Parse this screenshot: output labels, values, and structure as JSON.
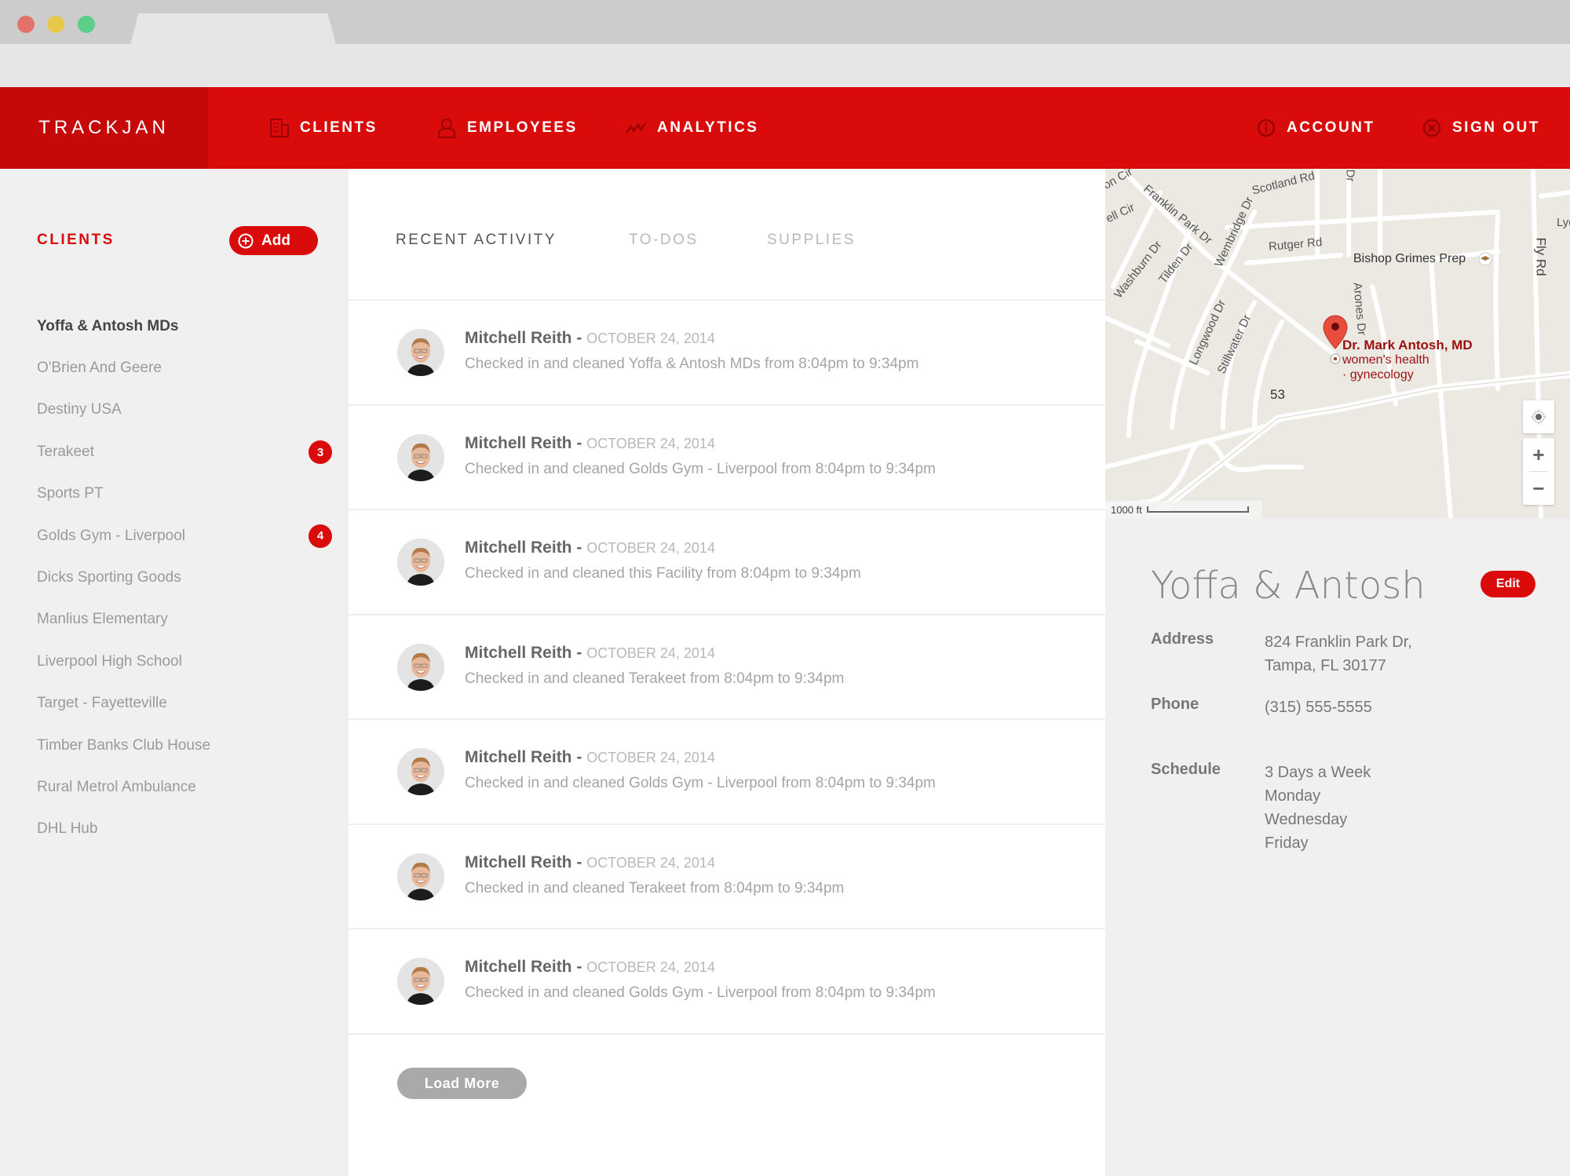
{
  "browser": {
    "tab_title": ""
  },
  "header": {
    "logo": "TRACKJAN",
    "nav": [
      {
        "label": "CLIENTS",
        "icon": "building-icon"
      },
      {
        "label": "EMPLOYEES",
        "icon": "user-icon"
      },
      {
        "label": "ANALYTICS",
        "icon": "trend-icon"
      }
    ],
    "right_nav": [
      {
        "label": "ACCOUNT",
        "icon": "info-icon"
      },
      {
        "label": "SIGN OUT",
        "icon": "close-circle-icon"
      }
    ]
  },
  "sidebar": {
    "title": "CLIENTS",
    "add_label": "Add",
    "clients": [
      {
        "name": "Yoffa & Antosh MDs",
        "active": true,
        "badge": null
      },
      {
        "name": "O'Brien And Geere",
        "badge": null
      },
      {
        "name": "Destiny USA",
        "badge": null
      },
      {
        "name": "Terakeet",
        "badge": "3"
      },
      {
        "name": "Sports PT",
        "badge": null
      },
      {
        "name": "Golds Gym - Liverpool",
        "badge": "4"
      },
      {
        "name": "Dicks Sporting Goods",
        "badge": null
      },
      {
        "name": "Manlius Elementary",
        "badge": null
      },
      {
        "name": "Liverpool High School",
        "badge": null
      },
      {
        "name": "Target - Fayetteville",
        "badge": null
      },
      {
        "name": "Timber Banks Club House",
        "badge": null
      },
      {
        "name": "Rural Metrol Ambulance",
        "badge": null
      },
      {
        "name": "DHL Hub",
        "badge": null
      }
    ]
  },
  "main": {
    "tabs": [
      {
        "label": "RECENT ACTIVITY",
        "active": true
      },
      {
        "label": "TO-DOS",
        "active": false
      },
      {
        "label": "SUPPLIES",
        "active": false
      }
    ],
    "separator": "-",
    "activities": [
      {
        "name": "Mitchell Reith",
        "date": "OCTOBER 24, 2014",
        "description": "Checked in and cleaned Yoffa & Antosh MDs from 8:04pm to 9:34pm"
      },
      {
        "name": "Mitchell Reith",
        "date": "OCTOBER 24, 2014",
        "description": "Checked in and cleaned Golds Gym - Liverpool from 8:04pm to 9:34pm"
      },
      {
        "name": "Mitchell Reith",
        "date": "OCTOBER 24, 2014",
        "description": "Checked in and cleaned this Facility from 8:04pm to 9:34pm"
      },
      {
        "name": "Mitchell Reith",
        "date": "OCTOBER 24, 2014",
        "description": "Checked in and cleaned Terakeet from 8:04pm to 9:34pm"
      },
      {
        "name": "Mitchell Reith",
        "date": "OCTOBER 24, 2014",
        "description": "Checked in and cleaned Golds Gym - Liverpool from 8:04pm to 9:34pm"
      },
      {
        "name": "Mitchell Reith",
        "date": "OCTOBER 24, 2014",
        "description": "Checked in and cleaned Terakeet from 8:04pm to 9:34pm"
      },
      {
        "name": "Mitchell Reith",
        "date": "OCTOBER 24, 2014",
        "description": "Checked in and cleaned Golds Gym - Liverpool from 8:04pm to 9:34pm"
      }
    ],
    "load_more_label": "Load More"
  },
  "map": {
    "streets": [
      "Scotland Rd",
      "Franklin Park Dr",
      "Rutger Rd",
      "Washburn Dr",
      "Tilden Dr",
      "Wembridge Dr",
      "Longwood Dr",
      "Stillwater Dr",
      "Arones Dr",
      "Fly Rd",
      "53",
      "on Cir",
      "ell Cir",
      "Lyc",
      "Dr"
    ],
    "poi": "Bishop Grimes Prep",
    "pin_title": "Dr. Mark Antosh, MD",
    "pin_subtitle_1": "women's health",
    "pin_subtitle_2": "· gynecology",
    "scale_label": "1000 ft",
    "zoom_in": "+",
    "zoom_out": "−"
  },
  "details": {
    "title": "Yoffa & Antosh",
    "edit_label": "Edit",
    "address_label": "Address",
    "address_line1": "824 Franklin Park Dr,",
    "address_line2": "Tampa, FL 30177",
    "phone_label": "Phone",
    "phone": "(315) 555-5555",
    "schedule_label": "Schedule",
    "schedule": [
      "3 Days a Week",
      "Monday",
      "Wednesday",
      "Friday"
    ]
  },
  "colors": {
    "brand_red": "#d90b0b",
    "brand_red_dark": "#c50909",
    "sidebar_bg": "#f0f0f0",
    "muted_text": "#9a9a9a"
  }
}
